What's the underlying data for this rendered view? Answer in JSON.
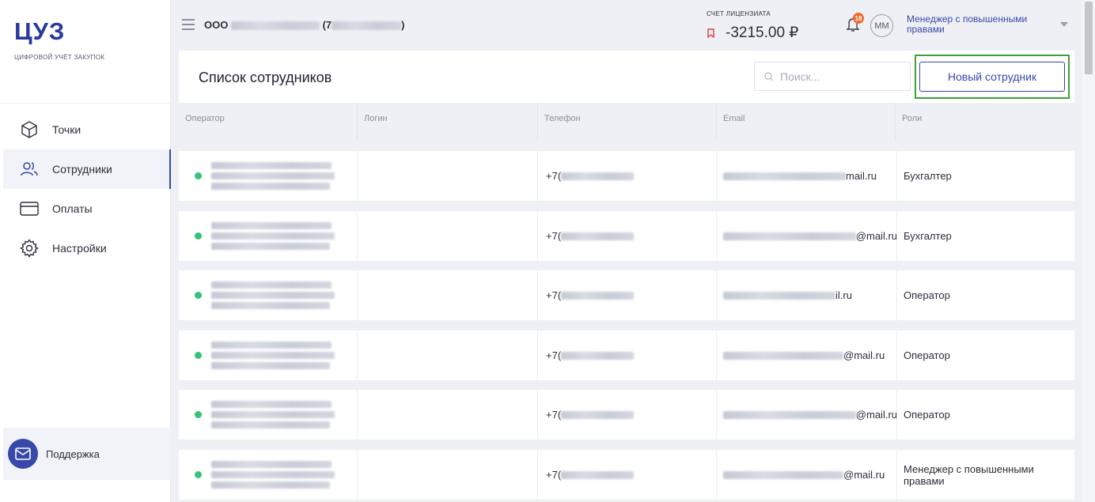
{
  "sidebar": {
    "logo": "ЦУЗ",
    "logo_sub": "ЦИФРОВОЙ УЧЁТ ЗАКУПОК",
    "items": [
      {
        "label": "Точки",
        "icon": "cube-icon"
      },
      {
        "label": "Сотрудники",
        "icon": "users-icon",
        "active": true
      },
      {
        "label": "Оплаты",
        "icon": "card-icon"
      },
      {
        "label": "Настройки",
        "icon": "gear-icon"
      }
    ],
    "support_label": "Поддержка"
  },
  "header": {
    "org_prefix": "ООО",
    "org_open_paren": "(7",
    "org_close_paren": ")",
    "account_label": "СЧЕТ ЛИЦЕНЗИАТА",
    "account_amount": "-3215.00 ₽",
    "notifications_count": "18",
    "avatar_initials": "ММ",
    "user_role": "Менеджер с повышенными правами"
  },
  "page": {
    "title": "Список сотрудников",
    "search_placeholder": "Поиск...",
    "new_button": "Новый сотрудник"
  },
  "table": {
    "columns": [
      "Оператор",
      "Логин",
      "Телефон",
      "Email",
      "Роли"
    ],
    "rows": [
      {
        "phone_prefix": "+7(",
        "email_suffix": "mail.ru",
        "role": "Бухгалтер"
      },
      {
        "phone_prefix": "+7(",
        "email_suffix": "@mail.ru",
        "role": "Бухгалтер"
      },
      {
        "phone_prefix": "+7(",
        "email_suffix": "il.ru",
        "role": "Оператор"
      },
      {
        "phone_prefix": "+7(",
        "email_suffix": "@mail.ru",
        "role": "Оператор"
      },
      {
        "phone_prefix": "+7(",
        "email_suffix": "@mail.ru",
        "role": "Оператор"
      },
      {
        "phone_prefix": "+7(",
        "email_suffix": "@mail.ru",
        "role": "Менеджер с повышенными правами"
      }
    ]
  },
  "colors": {
    "accent": "#3748a8",
    "status_active": "#35c27a",
    "badge": "#f06a2f",
    "highlight": "#3fa033"
  }
}
